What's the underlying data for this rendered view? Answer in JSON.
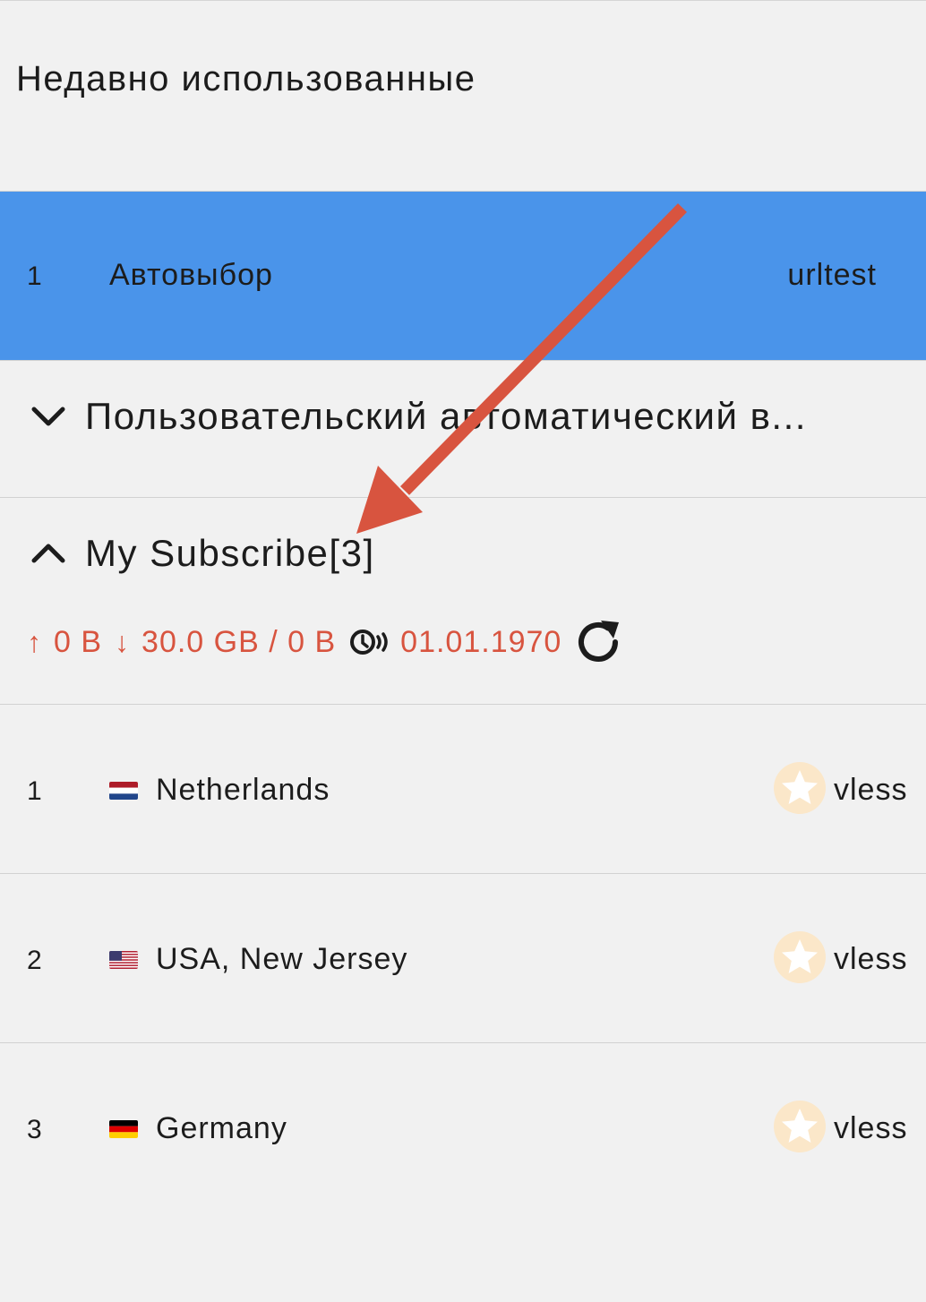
{
  "recent": {
    "title": "Недавно использованные",
    "selected": {
      "index": "1",
      "name": "Автовыбор",
      "type": "urltest"
    }
  },
  "groups": [
    {
      "title": "Пользовательский автоматический в...",
      "expanded": false,
      "icon": "chevron-down-icon"
    },
    {
      "title": "My Subscribe[3]",
      "expanded": true,
      "icon": "chevron-up-icon",
      "stats": {
        "upload_arrow": "↑",
        "upload": "0 B",
        "download_arrow": "↓",
        "download_total": "30.0 GB / 0 B",
        "expire_icon": "clock-sync-icon",
        "expire_date": "01.01.1970",
        "refresh_icon": "refresh-icon"
      },
      "items": [
        {
          "index": "1",
          "flag": "NL",
          "name": "Netherlands",
          "type": "vless",
          "icon": "star-icon"
        },
        {
          "index": "2",
          "flag": "US",
          "name": "USA, New Jersey",
          "type": "vless",
          "icon": "star-icon"
        },
        {
          "index": "3",
          "flag": "DE",
          "name": "Germany",
          "type": "vless",
          "icon": "star-icon"
        }
      ]
    }
  ],
  "colors": {
    "background": "#f1f1f1",
    "selected": "#4a94ea",
    "stats_text": "#d8543f",
    "annotation_arrow": "#d8543f",
    "star_badge": "#fbe7c9"
  }
}
